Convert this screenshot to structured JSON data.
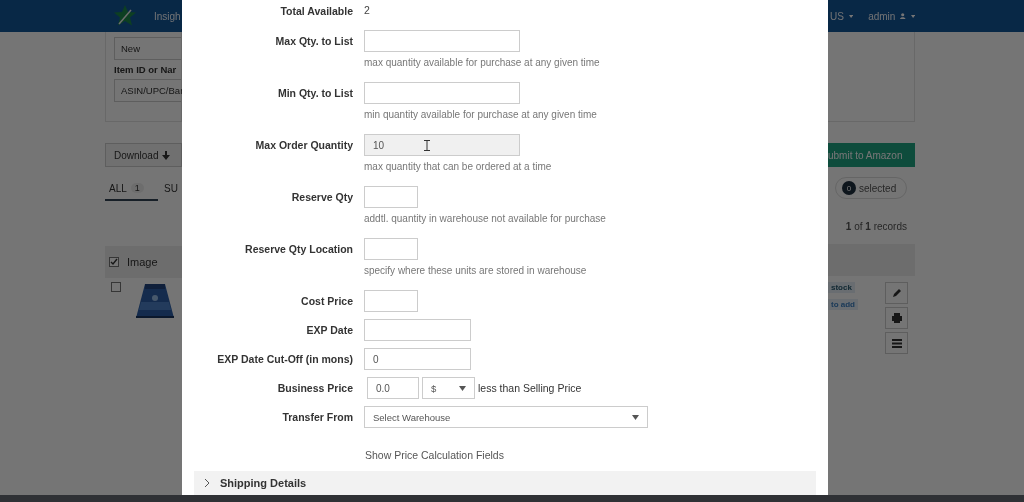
{
  "background_page": {
    "navbar": {
      "brand": "Insigh",
      "menu": "US",
      "user": "admin"
    },
    "condition_select": {
      "value": "New"
    },
    "item_id_label": "Item ID or Nar",
    "item_id_field": {
      "placeholder": "ASIN/UPC/Bar"
    },
    "download_button": "Download",
    "submit_button": "ubmit to Amazon",
    "tabs": [
      {
        "label": "ALL",
        "count": "1",
        "selected": true
      },
      {
        "label": "SU",
        "selected": false
      }
    ],
    "selected_count": {
      "count": "0",
      "label": "selected"
    },
    "records": "**1** of **1** records",
    "table": {
      "select_all_checked": true,
      "columns": [
        "Image"
      ],
      "rows": [
        {
          "checked": false,
          "tags": [
            "stock",
            "to add"
          ]
        }
      ]
    }
  },
  "modal": {
    "fields": [
      {
        "kind": "value",
        "label": "Total Available",
        "value": "2"
      },
      {
        "kind": "wide-input",
        "label": "Max Qty. to List",
        "help": "max quantity available for purchase at any given time",
        "focused": false
      },
      {
        "kind": "wide-input",
        "label": "Min Qty. to List",
        "help": "min quantity available for purchase at any given time",
        "focused": false
      },
      {
        "kind": "wide-input",
        "label": "Max Order Quantity",
        "value": "10",
        "help": "max quantity that can be ordered at a time",
        "focused": true
      },
      {
        "kind": "short-input",
        "label": "Reserve Qty",
        "help": "addtl. quantity in warehouse not available for purchase",
        "focused": false
      },
      {
        "kind": "short-input",
        "label": "Reserve Qty Location",
        "help": "specify where these units are stored in warehouse",
        "focused": false
      },
      {
        "kind": "short-input",
        "label": "Cost Price",
        "focused": false
      },
      {
        "kind": "mid-input",
        "label": "EXP Date",
        "focused": false
      },
      {
        "kind": "mid-input",
        "label": "EXP Date Cut-Off (in mons)",
        "value": "0",
        "focused": false
      },
      {
        "kind": "price",
        "label": "Business Price",
        "value": "0.0",
        "unit": "$",
        "note": "less than Selling Price"
      },
      {
        "kind": "select",
        "label": "Transfer From",
        "placeholder": "Select Warehouse"
      }
    ],
    "link": "Show Price Calculation Fields",
    "sections": [
      {
        "title": "Shipping Details",
        "expanded": false
      }
    ]
  }
}
